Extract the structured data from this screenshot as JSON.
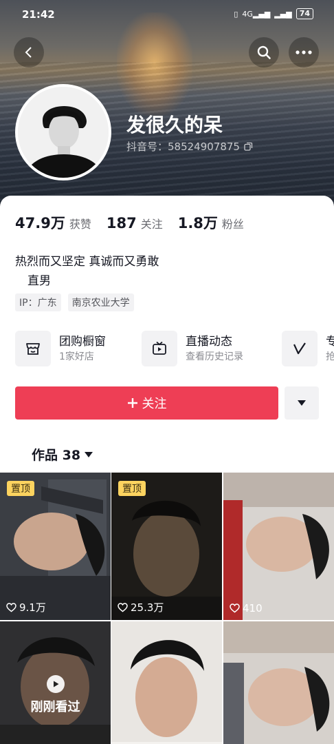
{
  "status_bar": {
    "time": "21:42",
    "battery": "74",
    "network": "4G"
  },
  "profile": {
    "nickname": "发很久的呆",
    "douyin_id": "抖音号：58524907875"
  },
  "stats": [
    {
      "value": "47.9万",
      "label": "获赞"
    },
    {
      "value": "187",
      "label": "关注"
    },
    {
      "value": "1.8万",
      "label": "粉丝"
    }
  ],
  "bio": {
    "line1": "热烈而又坚定 真诚而又勇敢",
    "line2": "直男"
  },
  "tags": [
    "IP：广东",
    "南京农业大学"
  ],
  "services": [
    {
      "title": "团购橱窗",
      "subtitle": "1家好店",
      "icon": "shop-window-icon"
    },
    {
      "title": "直播动态",
      "subtitle": "查看历史记录",
      "icon": "tv-icon"
    },
    {
      "title": "专",
      "subtitle": "抢",
      "icon": "v-logo-icon"
    }
  ],
  "actions": {
    "follow_label": "关注"
  },
  "works_tab": {
    "label": "作品 38"
  },
  "videos": [
    {
      "pinned": "置顶",
      "likes": "9.1万"
    },
    {
      "pinned": "置顶",
      "likes": "25.3万"
    },
    {
      "likes": "410"
    },
    {
      "recent": "刚刚看过"
    },
    {},
    {}
  ],
  "colors": {
    "accent": "#ee3e55",
    "pin_badge": "#fcd35f"
  }
}
